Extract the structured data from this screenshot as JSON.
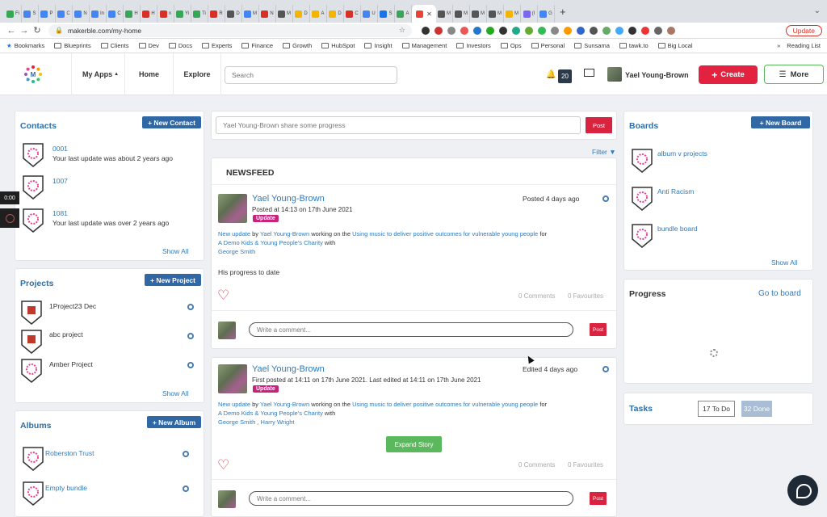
{
  "browser": {
    "tabs": [
      "Fi",
      "S",
      "P",
      "C",
      "N",
      "In",
      "C",
      "H",
      "H",
      "n",
      "Yi",
      "Ti",
      "R",
      "D",
      "M",
      "N",
      "M",
      "D",
      "A",
      "D",
      "C",
      "U",
      "S",
      "A",
      "",
      "M",
      "M",
      "M",
      "M",
      "M",
      "(I",
      "G"
    ],
    "url": "makerble.com/my-home",
    "update_label": "Update",
    "bookmarks": [
      "Bookmarks",
      "Blueprints",
      "Clients",
      "Dev",
      "Docs",
      "Experts",
      "Finance",
      "Growth",
      "HubSpot",
      "Insight",
      "Management",
      "Investors",
      "Ops",
      "Personal",
      "Sunsama",
      "tawk.to",
      "Big Local"
    ],
    "reading_list": "Reading List"
  },
  "header": {
    "my_apps": "My Apps",
    "home": "Home",
    "explore": "Explore",
    "search_placeholder": "Search",
    "notif_count": "20",
    "user_name": "Yael Young-Brown",
    "create_label": "Create",
    "more_label": "More"
  },
  "contacts": {
    "title": "Contacts",
    "new_label": "+ New Contact",
    "items": [
      {
        "name": "0001",
        "status": "Your last update was about 2 years ago"
      },
      {
        "name": "1007",
        "status": ""
      },
      {
        "name": "1081",
        "status": "Your last update was over 2 years ago"
      }
    ],
    "show_all": "Show All"
  },
  "projects": {
    "title": "Projects",
    "new_label": "+ New Project",
    "items": [
      "1Project23 Dec",
      "abc project",
      "Amber Project"
    ],
    "show_all": "Show All"
  },
  "albums": {
    "title": "Albums",
    "new_label": "+ New Album",
    "items": [
      "Roberston Trust",
      "Empty bundle"
    ]
  },
  "feed": {
    "post_placeholder": "Yael Young-Brown share some progress",
    "post_label": "Post",
    "filter_label": "Filter",
    "newsfeed_title": "NEWSFEED",
    "posts": [
      {
        "author": "Yael Young-Brown",
        "posted_at": "Posted at 14:13 on 17th June 2021",
        "tag": "Update",
        "age": "Posted 4 days ago",
        "line_prefix": "New update",
        "line_by": " by ",
        "line_working": " working on the ",
        "project": "Using music to deliver positive outcomes for vulnerable young people",
        "line_for": " for",
        "charity": "A Demo Kids & Young People's Charity",
        "line_with": " with",
        "with_people": "George Smith",
        "body": "His progress to date",
        "comments": "0 Comments",
        "favourites": "0 Favourites",
        "comment_placeholder": "Write a comment...",
        "post_label": "Post"
      },
      {
        "author": "Yael Young-Brown",
        "posted_at": "First posted at 14:11 on 17th June 2021. Last edited at 14:11 on 17th June 2021",
        "tag": "Update",
        "age": "Edited 4 days ago",
        "line_prefix": "New update",
        "line_by": " by ",
        "line_working": " working on the ",
        "project": "Using music to deliver positive outcomes for vulnerable young people",
        "line_for": " for",
        "charity": "A Demo Kids & Young People's Charity",
        "line_with": " with",
        "with_people": "George Smith , Harry Wright",
        "expand_label": "Expand Story",
        "comments": "0 Comments",
        "favourites": "0 Favourites",
        "comment_placeholder": "Write a comment...",
        "post_label": "Post"
      }
    ]
  },
  "boards": {
    "title": "Boards",
    "new_label": "+ New Board",
    "items": [
      "album v projects",
      "Anti Racism",
      "bundle board"
    ],
    "show_all": "Show All"
  },
  "progress": {
    "title": "Progress",
    "go_to_board": "Go to board"
  },
  "tasks": {
    "title": "Tasks",
    "todo": "17 To Do",
    "done": "32 Done"
  },
  "recorder": {
    "timer": "0:00"
  },
  "colors": {
    "brand_blue": "#2f68a5",
    "create_red": "#e3223f",
    "update_tag": "#c8227d",
    "expand_green": "#5cb85c"
  }
}
